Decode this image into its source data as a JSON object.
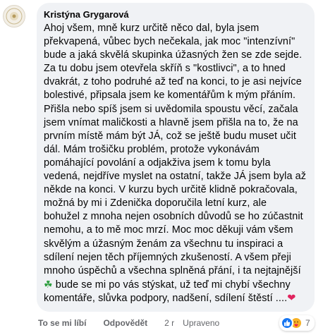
{
  "comment": {
    "author": "Kristýna Grygarová",
    "lines": [
      "Ahoj všem, mně kurz určitě něco dal, byla jsem",
      "překvapená, vůbec bych nečekala, jak moc \"intenzívní\"",
      "bude a jaká skvělá skupinka úžasných žen se zde sejde.",
      "Za tu dobu jsem otevřela skříň s \"kostlivci\", a to hned",
      "dvakrát, z toho podruhé až teď na konci, to je asi nejvíce",
      "bolestivé, připsala jsem ke komentářům k mým přáním.",
      "Přišla nebo spíš jsem si uvědomila spoustu věcí, začala",
      "jsem vnímat maličkosti a hlavně jsem přišla na to, že na",
      "prvním místě mám být JÁ, což se ještě budu muset učit",
      "dál. Mám trošičku problém, protože vykonávám",
      "pomáhající povolání a odjakživa jsem k tomu byla",
      "vedená, nejdříve myslet na ostatní, takže JÁ jsem byla až",
      "někde na konci. V kurzu bych určitě klidně pokračovala,",
      "možná by mi i Zdenička doporučila letní kurz, ale",
      "bohužel z mnoha nejen osobních důvodů se ho zúčastnit",
      "nemohu, a to mě moc mrzí. Moc moc děkuji vám všem",
      "skvělým a úžasným ženám za všechnu tu inspiraci a",
      "sdílení nejen těch příjemných zkušeností. A všem přeji",
      "mnoho úspěchů a všechna splněná přání, i ta nejtajnější"
    ],
    "line_clover": "bude se mi po vás stýskat, už teď mi chybí všechny",
    "line_last": "komentáře, slůvka podpory, nadšení, sdílení štěstí ....",
    "clover_glyph": "☘",
    "heart_glyph": "❤",
    "icons": {
      "clover": "four-leaf-clover-icon",
      "heart": "heart-emoji-icon",
      "like": "like-reaction-icon",
      "care": "care-reaction-icon"
    }
  },
  "actions": {
    "like_label": "To se mi líbí",
    "reply_label": "Odpovědět",
    "timestamp": "2 r",
    "edited_label": "Upraveno"
  },
  "reactions": {
    "count": "7",
    "colors": {
      "like": "#1877f2",
      "care": "#f7b125"
    }
  }
}
